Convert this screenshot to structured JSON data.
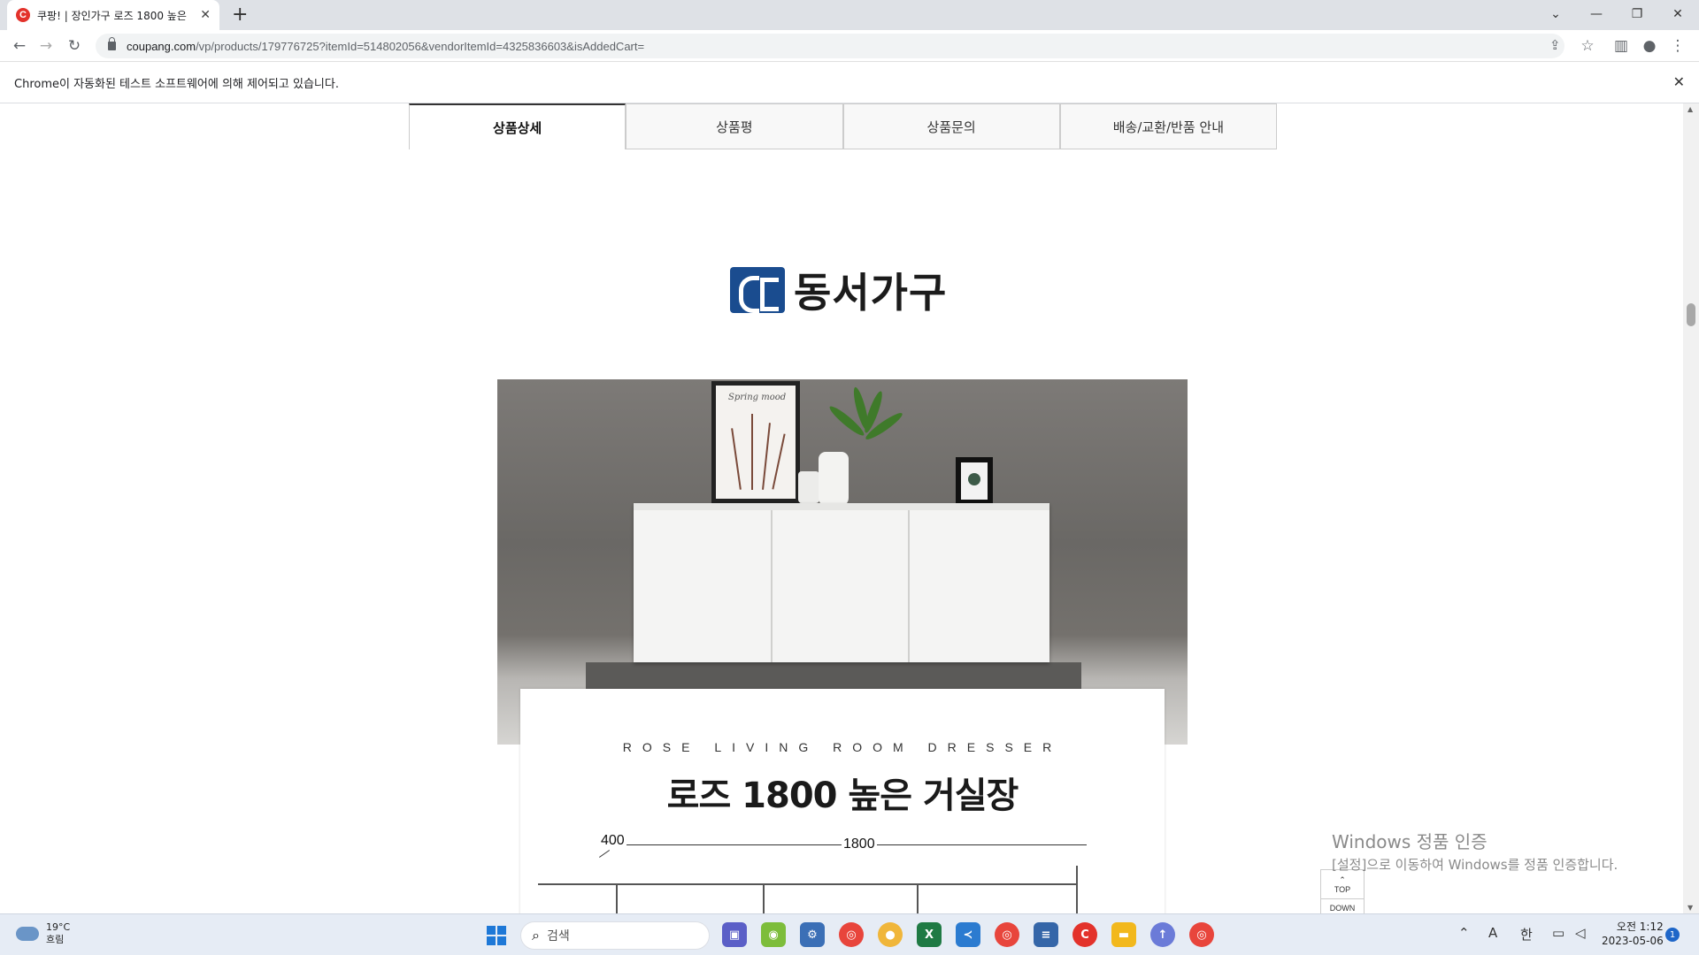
{
  "browser": {
    "tab_title": "쿠팡! | 장인가구 로즈 1800 높은",
    "favicon_letter": "C",
    "new_tab_glyph": "+",
    "url_domain": "coupang.com",
    "url_path": "/vp/products/179776725?itemId=514802056&vendorItemId=4325836603&isAddedCart=",
    "infobar_text": "Chrome이 자동화된 테스트 소프트웨어에 의해 제어되고 있습니다."
  },
  "product_tabs": [
    {
      "label": "상품상세"
    },
    {
      "label": "상품평"
    },
    {
      "label": "상품문의"
    },
    {
      "label": "배송/교환/반품 안내"
    }
  ],
  "detail": {
    "brand_name": "동서가구",
    "frame_text": "Spring mood",
    "subtitle": "ROSE LIVING ROOM DRESSER",
    "title": "로즈 1800 높은 거실장",
    "dim_depth": "400",
    "dim_width": "1800"
  },
  "side_nav": {
    "top_label": "TOP",
    "down_label": "DOWN"
  },
  "watermark": {
    "line1": "Windows 정품 인증",
    "line2": "[설정]으로 이동하여 Windows를 정품 인증합니다."
  },
  "taskbar": {
    "weather_temp": "19°C",
    "weather_desc": "흐림",
    "search_placeholder": "검색",
    "ime_lang_a": "A",
    "ime_lang_han": "한",
    "clock_time": "오전 1:12",
    "clock_date": "2023-05-06",
    "notification_count": "1"
  },
  "colors": {
    "brand_blue": "#1a4c8f",
    "coupang_red": "#e3322b",
    "windows_blue": "#1e78d7"
  }
}
